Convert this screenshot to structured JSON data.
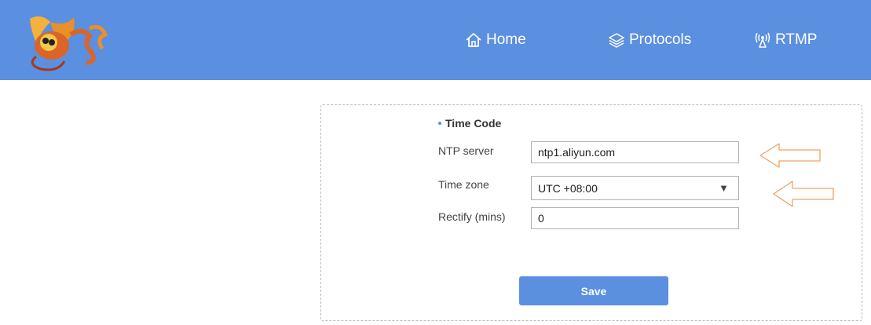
{
  "header": {
    "nav": [
      {
        "label": "Home",
        "icon": "home-icon"
      },
      {
        "label": "Protocols",
        "icon": "layers-icon"
      },
      {
        "label": "RTMP",
        "icon": "antenna-icon"
      }
    ],
    "brand_color": "#5b8fe0"
  },
  "form": {
    "section_title": "Time Code",
    "ntp_server": {
      "label": "NTP server",
      "value": "ntp1.aliyun.com"
    },
    "time_zone": {
      "label": "Time zone",
      "value": "UTC +08:00"
    },
    "rectify": {
      "label": "Rectify (mins)",
      "value": "0"
    },
    "save_label": "Save"
  },
  "annotation": {
    "arrow_color": "#f0a060"
  }
}
